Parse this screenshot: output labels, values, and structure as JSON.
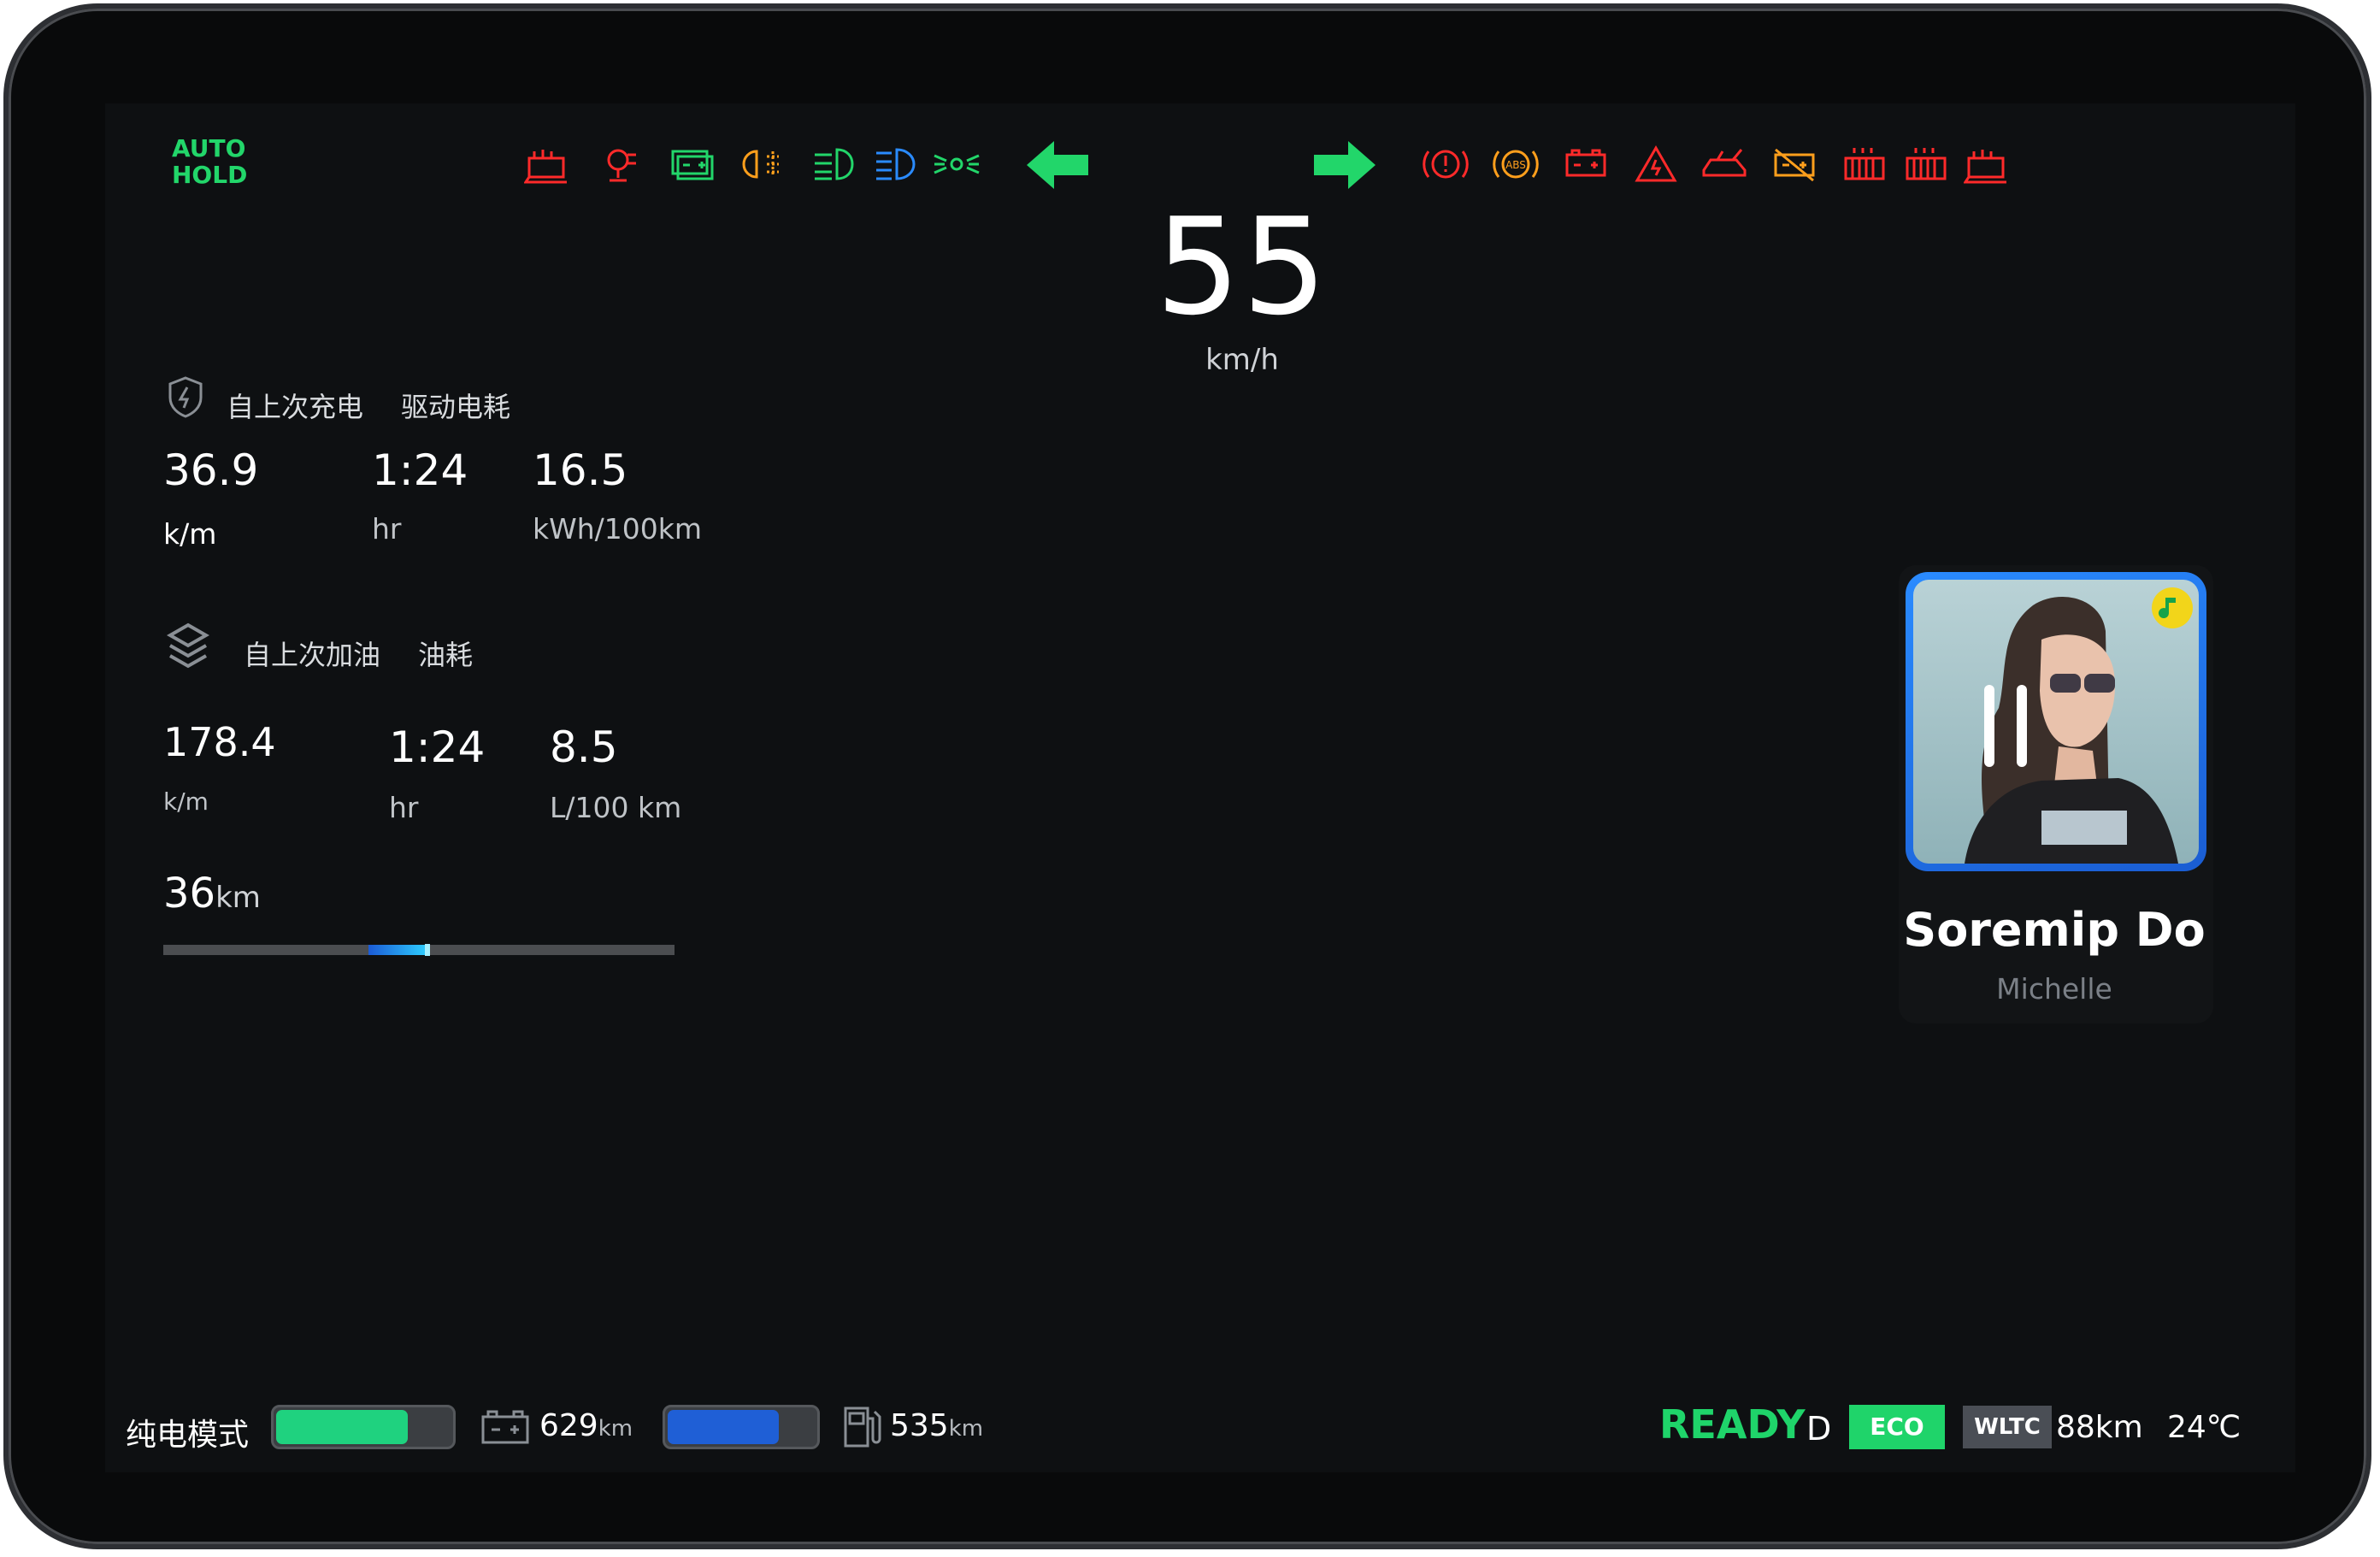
{
  "top": {
    "auto_hold_line1": "AUTO",
    "auto_hold_line2": "HOLD",
    "indicators_left": [
      "seat-heater-icon",
      "ev-plug-fault-icon",
      "battery-system-icon",
      "fog-light-icon",
      "front-fog-light-icon",
      "high-beam-icon",
      "position-light-icon"
    ],
    "indicators_right": [
      "brake-warning-icon",
      "abs-icon",
      "battery-icon",
      "hazard-icon",
      "door-open-icon",
      "battery-fault-icon",
      "heater-icon",
      "heater-icon",
      "seat-heater-icon"
    ],
    "colors": {
      "red": "#ff2a2a",
      "green": "#22d66a",
      "orange": "#ff9f1c",
      "blue": "#2a8bff"
    }
  },
  "speed": {
    "value": "55",
    "unit": "km/h"
  },
  "charge_section": {
    "label_since_charge": "自上次充电",
    "label_drive_consumption": "驱动电耗",
    "distance": "36.9",
    "distance_unit": "k/m",
    "time": "1:24",
    "time_unit": "hr",
    "consumption": "16.5",
    "consumption_unit": "kWh/100km"
  },
  "fuel_section": {
    "label_since_refuel": "自上次加油",
    "label_fuel_consumption": "油耗",
    "distance": "178.4",
    "distance_unit": "k/m",
    "time": "1:24",
    "time_unit": "hr",
    "consumption": "8.5",
    "consumption_unit": "L/100 km"
  },
  "trip": {
    "value": "36",
    "unit": "km",
    "progress_fraction": 0.44
  },
  "media": {
    "song": "Soremip Do",
    "artist": "Michelle"
  },
  "bottom": {
    "mode_label": "纯电模式",
    "ev_fill_fraction": 0.74,
    "ev_range": "629",
    "ev_range_unit": "km",
    "fuel_fill_fraction": 0.74,
    "fuel_range": "535",
    "fuel_range_unit": "km",
    "ready": "READY",
    "gear": "D",
    "eco": "ECO",
    "wltc": "WLTC",
    "wltc_range": "88km",
    "temperature": "24℃"
  }
}
